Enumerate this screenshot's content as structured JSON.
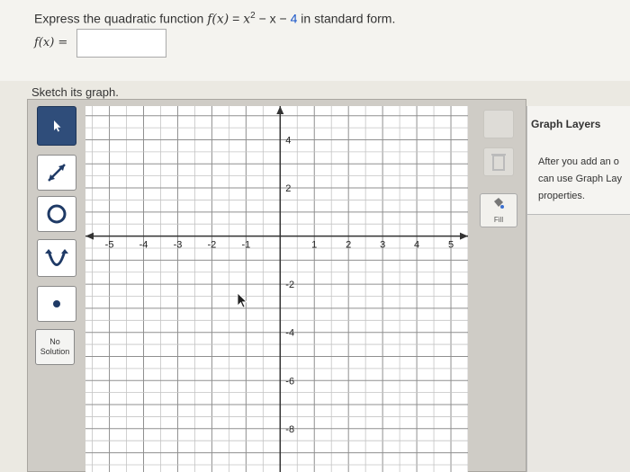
{
  "question": {
    "prefix": "Express the quadratic function ",
    "function_lhs": "f(x)",
    "equals": " = ",
    "x": "x",
    "exponent": "2",
    "minus_x": " − x − ",
    "constant": "4",
    "suffix": " in standard form.",
    "answer_label": "f(x) =",
    "answer_value": ""
  },
  "sketch_label": "Sketch its graph.",
  "tools": {
    "pointer": "pointer-icon",
    "line": "line-icon",
    "circle": "circle-icon",
    "parabola": "parabola-icon",
    "point": "point-icon",
    "no_solution": "No Solution"
  },
  "graph": {
    "x_ticks": [
      "-5",
      "-4",
      "-3",
      "-2",
      "-1",
      "1",
      "2",
      "3",
      "4",
      "5"
    ],
    "y_ticks": [
      "4",
      "2",
      "-2",
      "-4",
      "-6",
      "-8"
    ],
    "x_range": [
      -5.7,
      5.5
    ],
    "y_range": [
      -9.8,
      5.4
    ],
    "grid_step": 0.5
  },
  "right_tools": {
    "fill_label": "Fill",
    "delete_icon": "trash-icon",
    "fill_icon": "paint-bucket-icon"
  },
  "layers": {
    "title": "Graph Layers",
    "line1": "After you add an o",
    "line2": "can use Graph Lay",
    "line3": "properties."
  },
  "colors": {
    "accent": "#2f4d7a",
    "constant": "#1a56c8",
    "grid": "#9a9a9a"
  }
}
